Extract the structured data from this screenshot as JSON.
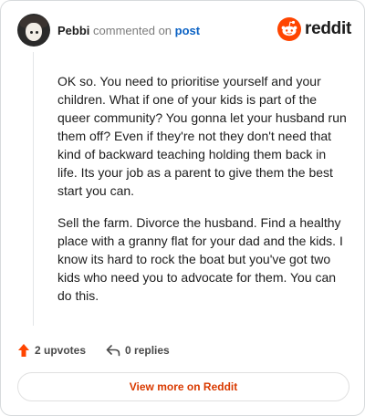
{
  "header": {
    "username": "Pebbi",
    "commented_on": "commented on",
    "post_link": "post",
    "brand": "reddit",
    "brand_color": "#ff4500"
  },
  "comment": {
    "paragraphs": [
      "OK so. You need to prioritise yourself and your children. What if one of your kids is part of the queer community? You gonna let your husband run them off? Even if they're not they don't need that kind of backward teaching holding them back in life. Its your job as a parent to give them the best start you can.",
      "Sell the farm. Divorce the husband. Find a healthy place with a granny flat for your dad and the kids. I know its hard to rock the boat but you've got two kids who need you to advocate for them. You can do this."
    ]
  },
  "actions": {
    "upvotes": "2 upvotes",
    "replies": "0 replies",
    "upvote_icon": "upvote-arrow-icon",
    "reply_icon": "reply-icon"
  },
  "footer": {
    "view_more": "View more on Reddit"
  }
}
